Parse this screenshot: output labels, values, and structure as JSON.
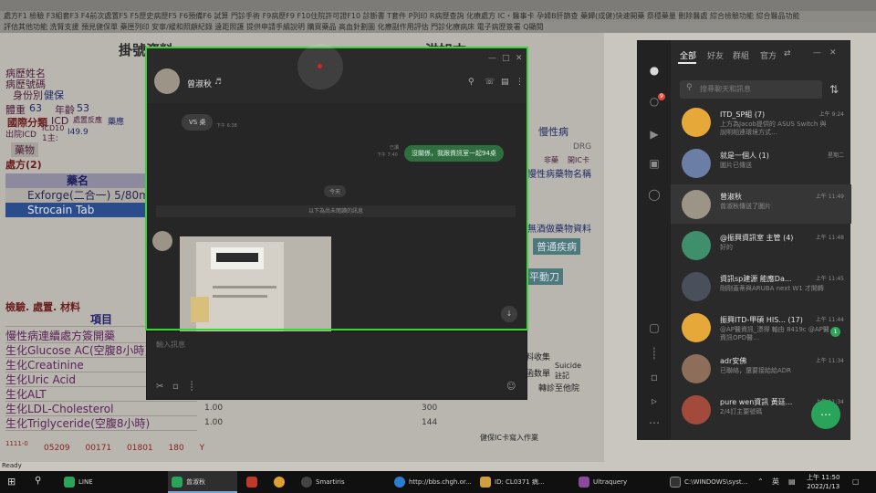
{
  "his": {
    "menu_row1": "處方F1   檢驗   F3組套F3   F4前次處置F5   F5歷史病歷F5   F6預備F6   試算   門診手術   F9病歷F9   F10住院許可證F10   診斷書   T套件   P列印   R病歷查詢   化療處方   IC・醫事卡   孕婦B肝篩查   藥歸(成健)快速開藥   祭穩藥量   刪除醫處   綜合檢驗功能   綜合醫品功能",
    "menu_row2": "評估其他功能   洗腎支援   預見健保單   藥匣列印   安寧/緩和照顧紀錄   遠距照護   提供申請手續說明   購買藥品   高血針劃圖   化療副作用評估   門診化療病床   電子病歷簽署   Q顯閱",
    "title_left": "掛號資料",
    "title_right": "洪旭本",
    "labels": [
      "病歷姓名",
      "病歷號碼",
      "身份別",
      "健保",
      "體重",
      "63",
      "年齡",
      "53",
      "國際分類",
      "ICD",
      "處置反應",
      "藥應",
      "出院ICD",
      "ICD10",
      "1主:",
      "I49.9",
      "藥物",
      "處方(2)"
    ],
    "drugs_header": "藥名",
    "drugs": [
      "Exforge(二合一) 5/80mg",
      "Strocain Tab"
    ],
    "section_lab": "檢驗. 處置. 材料",
    "lab_header": "項目",
    "labs": [
      "慢性病連續處方簽開藥",
      "生化Glucose AC(空腹8小時)",
      "生化Creatinine",
      "生化Uric Acid",
      "生化ALT",
      "生化LDL-Cholesterol",
      "生化Triglyceride(空腹8小時)"
    ],
    "lab_values": [
      "1.00",
      "1.00"
    ],
    "lab_counts": [
      "300",
      "144"
    ],
    "right_panel": [
      "慢性病",
      "非藥",
      "開IC卡",
      "DRG",
      "慢性病藥物名稱",
      "無酒做藥物資料",
      "普通疾病",
      "平動刀",
      "料收集",
      "函数單",
      "Suicide",
      "註記",
      "轉診至他院",
      "健保IC卡寫入作業"
    ],
    "status_values": [
      "05209",
      "00171",
      "01801",
      "180",
      "Y"
    ],
    "status_code": "1111-0",
    "ready": "Ready"
  },
  "line": {
    "filters": [
      "全部",
      "好友",
      "群組",
      "官方"
    ],
    "search_placeholder": "搜尋聊天和訊息",
    "rail_badge": "9",
    "chats": [
      {
        "name": "ITD_SP組 (7)",
        "time": "上午 9:24",
        "message": "上方為Jacob提供的 ASUS Switch 與說明相連環境方式…",
        "unread": ""
      },
      {
        "name": "就是一個人 (1)",
        "time": "星期二",
        "message": "圖片已傳送",
        "unread": ""
      },
      {
        "name": "曾淑秋",
        "time": "上午 11:49",
        "message": "曾淑秋傳送了圖片",
        "unread": ""
      },
      {
        "name": "@振興資訊室 主管 (4)",
        "time": "上午 11:48",
        "message": "好的",
        "unread": ""
      },
      {
        "name": "資訊sp建源 能應Da...",
        "time": "上午 11:45",
        "message": "剛剛蓋蒂與ARUBA next W1 才開轉",
        "unread": ""
      },
      {
        "name": "振興ITD-甲碩 HIS... (17)",
        "time": "上午 11:44",
        "message": "@AP醫資訊_漂得 軸由 8419c @AP醫資訊OPD醫…",
        "unread": "1"
      },
      {
        "name": "adr安佛",
        "time": "上午 11:34",
        "message": "已聯絡，還要接給給ADR",
        "unread": ""
      },
      {
        "name": "pure wen資訊 黃廷...",
        "time": "上午 11:34",
        "message": "2/4訂主要號碼",
        "unread": ""
      }
    ]
  },
  "chat": {
    "contact": "曾淑秋",
    "msg_vs": "VS 桌",
    "msg_vs_time": "下午 6:38",
    "msg_out": "沒關係，我跟資訊室一起94桌",
    "msg_out_read": "已讀",
    "msg_out_time": "下午 7:40",
    "date_chip": "今天",
    "unread_divider": "以下為尚未閱讀的訊息",
    "input_placeholder": "輸入訊息"
  },
  "taskbar": {
    "items": [
      "LINE",
      "曾淑秋",
      "Smartiris",
      "http://bbs.chgh.or...",
      "ID: CL0371    病...",
      "Ultraquery",
      "C:\\WINDOWS\\syst..."
    ],
    "ime": "英",
    "time": "上午 11:50",
    "date": "2022/1/13"
  },
  "colors": {
    "line_green": "#2aa45a",
    "selection_green": "#3bd23b",
    "bubble_out": "#2f6f3f"
  }
}
